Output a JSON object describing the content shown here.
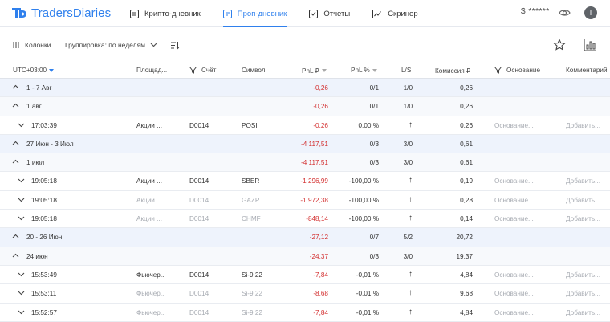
{
  "app": {
    "name": "TradersDiaries",
    "brand_color": "#2f80ed"
  },
  "nav": [
    {
      "label": "Крипто-дневник",
      "icon": "crypto-diary-icon",
      "active": false
    },
    {
      "label": "Проп-дневник",
      "icon": "prop-diary-icon",
      "active": true
    },
    {
      "label": "Отчеты",
      "icon": "reports-icon",
      "active": false
    },
    {
      "label": "Скринер",
      "icon": "screener-icon",
      "active": false
    }
  ],
  "header": {
    "balance": "$ ******",
    "avatar_letter": "I"
  },
  "toolbar": {
    "columns_label": "Колонки",
    "grouping_label": "Группировка: по неделям"
  },
  "columns": {
    "time": "UTC+03:00",
    "platform": "Площад...",
    "account": "Счёт",
    "symbol": "Символ",
    "pnl": "PnL ₽",
    "pnl_pct": "PnL %",
    "ls": "L/S",
    "commission": "Комиссия ₽",
    "reason": "Основание",
    "comment": "Комментарий"
  },
  "rows": [
    {
      "type": "grp",
      "expand": "up",
      "time": "1 - 7 Авг",
      "pnl": "-0,26",
      "pct": "0/1",
      "ls": "1/0",
      "comm": "0,26"
    },
    {
      "type": "sub",
      "expand": "up",
      "time": "1 авг",
      "pnl": "-0,26",
      "pct": "0/1",
      "ls": "1/0",
      "comm": "0,26"
    },
    {
      "type": "trade",
      "time": "17:03:39",
      "platform": "Акции ...",
      "account": "D0014",
      "symbol": "POSI",
      "pnl": "-0,26",
      "pct": "0,00 %",
      "ls": "↑",
      "comm": "0,26",
      "reason": "Основание...",
      "comment": "Добавить..."
    },
    {
      "type": "grp",
      "expand": "up",
      "time": "27 Июн - 3 Июл",
      "pnl": "-4 117,51",
      "pct": "0/3",
      "ls": "3/0",
      "comm": "0,61"
    },
    {
      "type": "sub",
      "expand": "up",
      "time": "1 июл",
      "pnl": "-4 117,51",
      "pct": "0/3",
      "ls": "3/0",
      "comm": "0,61"
    },
    {
      "type": "trade",
      "time": "19:05:18",
      "platform": "Акции ...",
      "account": "D0014",
      "symbol": "SBER",
      "pnl": "-1 296,99",
      "pct": "-100,00 %",
      "ls": "↑",
      "comm": "0,19",
      "reason": "Основание...",
      "comment": "Добавить..."
    },
    {
      "type": "trade",
      "time": "19:05:18",
      "platform": "Акции ...",
      "account": "D0014",
      "symbol": "GAZP",
      "pnl": "-1 972,38",
      "pct": "-100,00 %",
      "ls": "↑",
      "comm": "0,28",
      "reason": "Основание...",
      "comment": "Добавить..."
    },
    {
      "type": "trade",
      "time": "19:05:18",
      "platform": "Акции ...",
      "account": "D0014",
      "symbol": "CHMF",
      "pnl": "-848,14",
      "pct": "-100,00 %",
      "ls": "↑",
      "comm": "0,14",
      "reason": "Основание...",
      "comment": "Добавить..."
    },
    {
      "type": "grp",
      "expand": "up",
      "time": "20 - 26 Июн",
      "pnl": "-27,12",
      "pct": "0/7",
      "ls": "5/2",
      "comm": "20,72"
    },
    {
      "type": "sub",
      "expand": "up",
      "time": "24 июн",
      "pnl": "-24,37",
      "pct": "0/3",
      "ls": "3/0",
      "comm": "19,37"
    },
    {
      "type": "trade",
      "time": "15:53:49",
      "platform": "Фьючер...",
      "account": "D0014",
      "symbol": "Si-9.22",
      "pnl": "-7,84",
      "pct": "-0,01 %",
      "ls": "↑",
      "comm": "4,84",
      "reason": "Основание...",
      "comment": "Добавить..."
    },
    {
      "type": "trade",
      "time": "15:53:11",
      "platform": "Фьючер...",
      "account": "D0014",
      "symbol": "Si-9.22",
      "pnl": "-8,68",
      "pct": "-0,01 %",
      "ls": "↑",
      "comm": "9,68",
      "reason": "Основание...",
      "comment": "Добавить..."
    },
    {
      "type": "trade",
      "time": "15:52:57",
      "platform": "Фьючер...",
      "account": "D0014",
      "symbol": "Si-9.22",
      "pnl": "-7,84",
      "pct": "-0,01 %",
      "ls": "↑",
      "comm": "4,84",
      "reason": "Основание...",
      "comment": "Добавить..."
    }
  ]
}
